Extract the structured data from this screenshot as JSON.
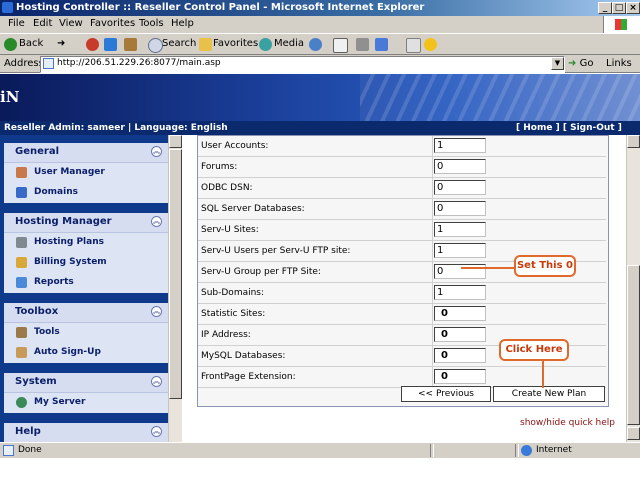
{
  "window": {
    "title": "Hosting Controller :: Reseller Control Panel - Microsoft Internet Explorer"
  },
  "menu": [
    "File",
    "Edit",
    "View",
    "Favorites",
    "Tools",
    "Help"
  ],
  "toolbar": {
    "back": "Back",
    "search": "Search",
    "favorites": "Favorites",
    "media": "Media"
  },
  "address": {
    "label": "Address",
    "url": "http://206.51.229.26:8077/main.asp",
    "go": "Go",
    "links": "Links"
  },
  "banner": {
    "logo": "iN"
  },
  "infobar": {
    "user": "Reseller Admin: sameer | Language: English",
    "home": "[ Home ]",
    "signout": "[ Sign-Out ]"
  },
  "sidebar": [
    {
      "title": "General",
      "items": [
        {
          "label": "User Manager",
          "icon": "users-icon"
        },
        {
          "label": "Domains",
          "icon": "domains-icon"
        }
      ]
    },
    {
      "title": "Hosting Manager",
      "items": [
        {
          "label": "Hosting Plans",
          "icon": "plans-icon"
        },
        {
          "label": "Billing System",
          "icon": "billing-icon"
        },
        {
          "label": "Reports",
          "icon": "reports-icon"
        }
      ]
    },
    {
      "title": "Toolbox",
      "items": [
        {
          "label": "Tools",
          "icon": "tools-icon"
        },
        {
          "label": "Auto Sign-Up",
          "icon": "signup-icon"
        }
      ]
    },
    {
      "title": "System",
      "items": [
        {
          "label": "My Server",
          "icon": "server-icon"
        }
      ]
    },
    {
      "title": "Help",
      "items": []
    }
  ],
  "form": {
    "rows": [
      {
        "label": "User Accounts:",
        "value": "1",
        "bold": false
      },
      {
        "label": "Forums:",
        "value": "0",
        "bold": false
      },
      {
        "label": "ODBC DSN:",
        "value": "0",
        "bold": false
      },
      {
        "label": "SQL Server Databases:",
        "value": "0",
        "bold": false
      },
      {
        "label": "Serv-U Sites:",
        "value": "1",
        "bold": false
      },
      {
        "label": "Serv-U Users per Serv-U FTP site:",
        "value": "1",
        "bold": false
      },
      {
        "label": "Serv-U Group per FTP Site:",
        "value": "0",
        "bold": false
      },
      {
        "label": "Sub-Domains:",
        "value": "1",
        "bold": false
      },
      {
        "label": "Statistic Sites:",
        "value": "0",
        "bold": true
      },
      {
        "label": "IP Address:",
        "value": "0",
        "bold": true
      },
      {
        "label": "MySQL Databases:",
        "value": "0",
        "bold": true
      },
      {
        "label": "FrontPage Extension:",
        "value": "0",
        "bold": true
      }
    ],
    "previous_label": "<<  Previous",
    "create_label": "Create New Plan",
    "quick_help": "show/hide quick help"
  },
  "callouts": {
    "set_this": "Set This 0",
    "click_here": "Click Here"
  },
  "status": {
    "left": "Done",
    "zone": "Internet"
  },
  "colors": {
    "callout": "#e06a2c",
    "sidebar_bg": "#0f3a8c",
    "header_bar": "#0b2a6e"
  }
}
